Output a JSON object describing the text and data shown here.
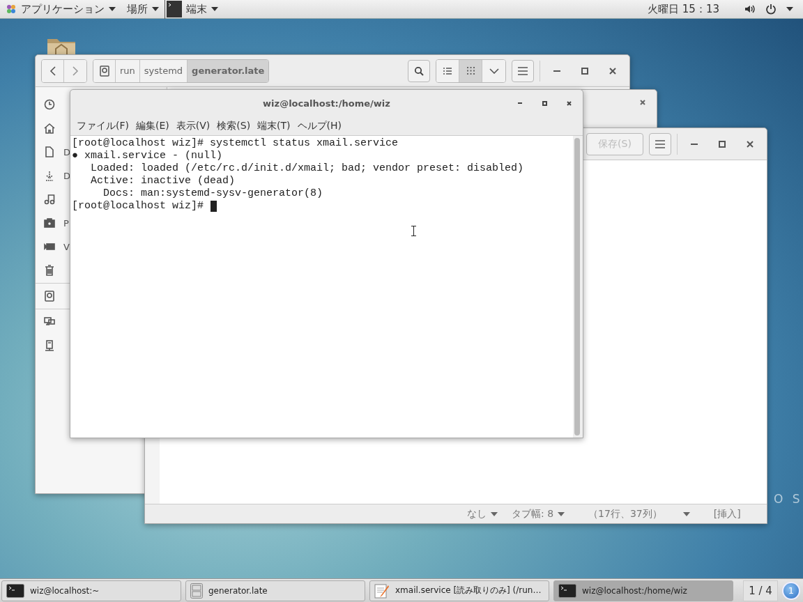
{
  "top_bar": {
    "applications_menu": "アプリケーション",
    "places_menu": "場所",
    "app_menu": "端末",
    "clock": "火曜日 15：13"
  },
  "desktop": {
    "logo_text": "O S"
  },
  "file_manager": {
    "path": [
      {
        "label": "run",
        "selected": false
      },
      {
        "label": "systemd",
        "selected": false
      },
      {
        "label": "generator.late",
        "selected": true
      }
    ],
    "views": [
      {
        "kind": "list",
        "selected": false
      },
      {
        "kind": "grid",
        "selected": true
      }
    ],
    "sidebar_sections": [
      {
        "items": [
          {
            "kind": "recent"
          },
          {
            "kind": "home"
          },
          {
            "kind": "document",
            "label": "D"
          },
          {
            "kind": "download",
            "label": "D"
          },
          {
            "kind": "music"
          },
          {
            "kind": "camera",
            "label": "P"
          },
          {
            "kind": "video",
            "label": "V"
          },
          {
            "kind": "trash"
          }
        ]
      },
      {
        "items": [
          {
            "kind": "drive"
          }
        ]
      },
      {
        "items": [
          {
            "kind": "network"
          },
          {
            "kind": "server"
          }
        ]
      }
    ]
  },
  "editor": {
    "save_button": {
      "label": "保存(S)",
      "disabled": true
    },
    "status_bar": {
      "highlight": "なし",
      "tab_width": "タブ幅: 8",
      "position": "（17行、37列）",
      "mode": "[挿入]"
    }
  },
  "terminal": {
    "title": "wiz@localhost:/home/wiz",
    "menu": [
      "ファイル(F)",
      "編集(E)",
      "表示(V)",
      "検索(S)",
      "端末(T)",
      "ヘルプ(H)"
    ],
    "lines": [
      "[root@localhost wiz]# systemctl status xmail.service",
      "● xmail.service - (null)",
      "   Loaded: loaded (/etc/rc.d/init.d/xmail; bad; vendor preset: disabled)",
      "   Active: inactive (dead)",
      "     Docs: man:systemd-sysv-generator(8)",
      "[root@localhost wiz]# "
    ],
    "cursor_visible": true
  },
  "taskbar": {
    "items": [
      {
        "kind": "terminal",
        "label": "wiz@localhost:~",
        "selected": false
      },
      {
        "kind": "files",
        "label": "generator.late",
        "selected": false
      },
      {
        "kind": "editor",
        "label": "xmail.service [読み取りのみ] (/run…",
        "selected": false
      },
      {
        "kind": "terminal",
        "label": "wiz@localhost:/home/wiz",
        "selected": true
      }
    ],
    "workspace": "1 / 4",
    "notifications": "1"
  }
}
